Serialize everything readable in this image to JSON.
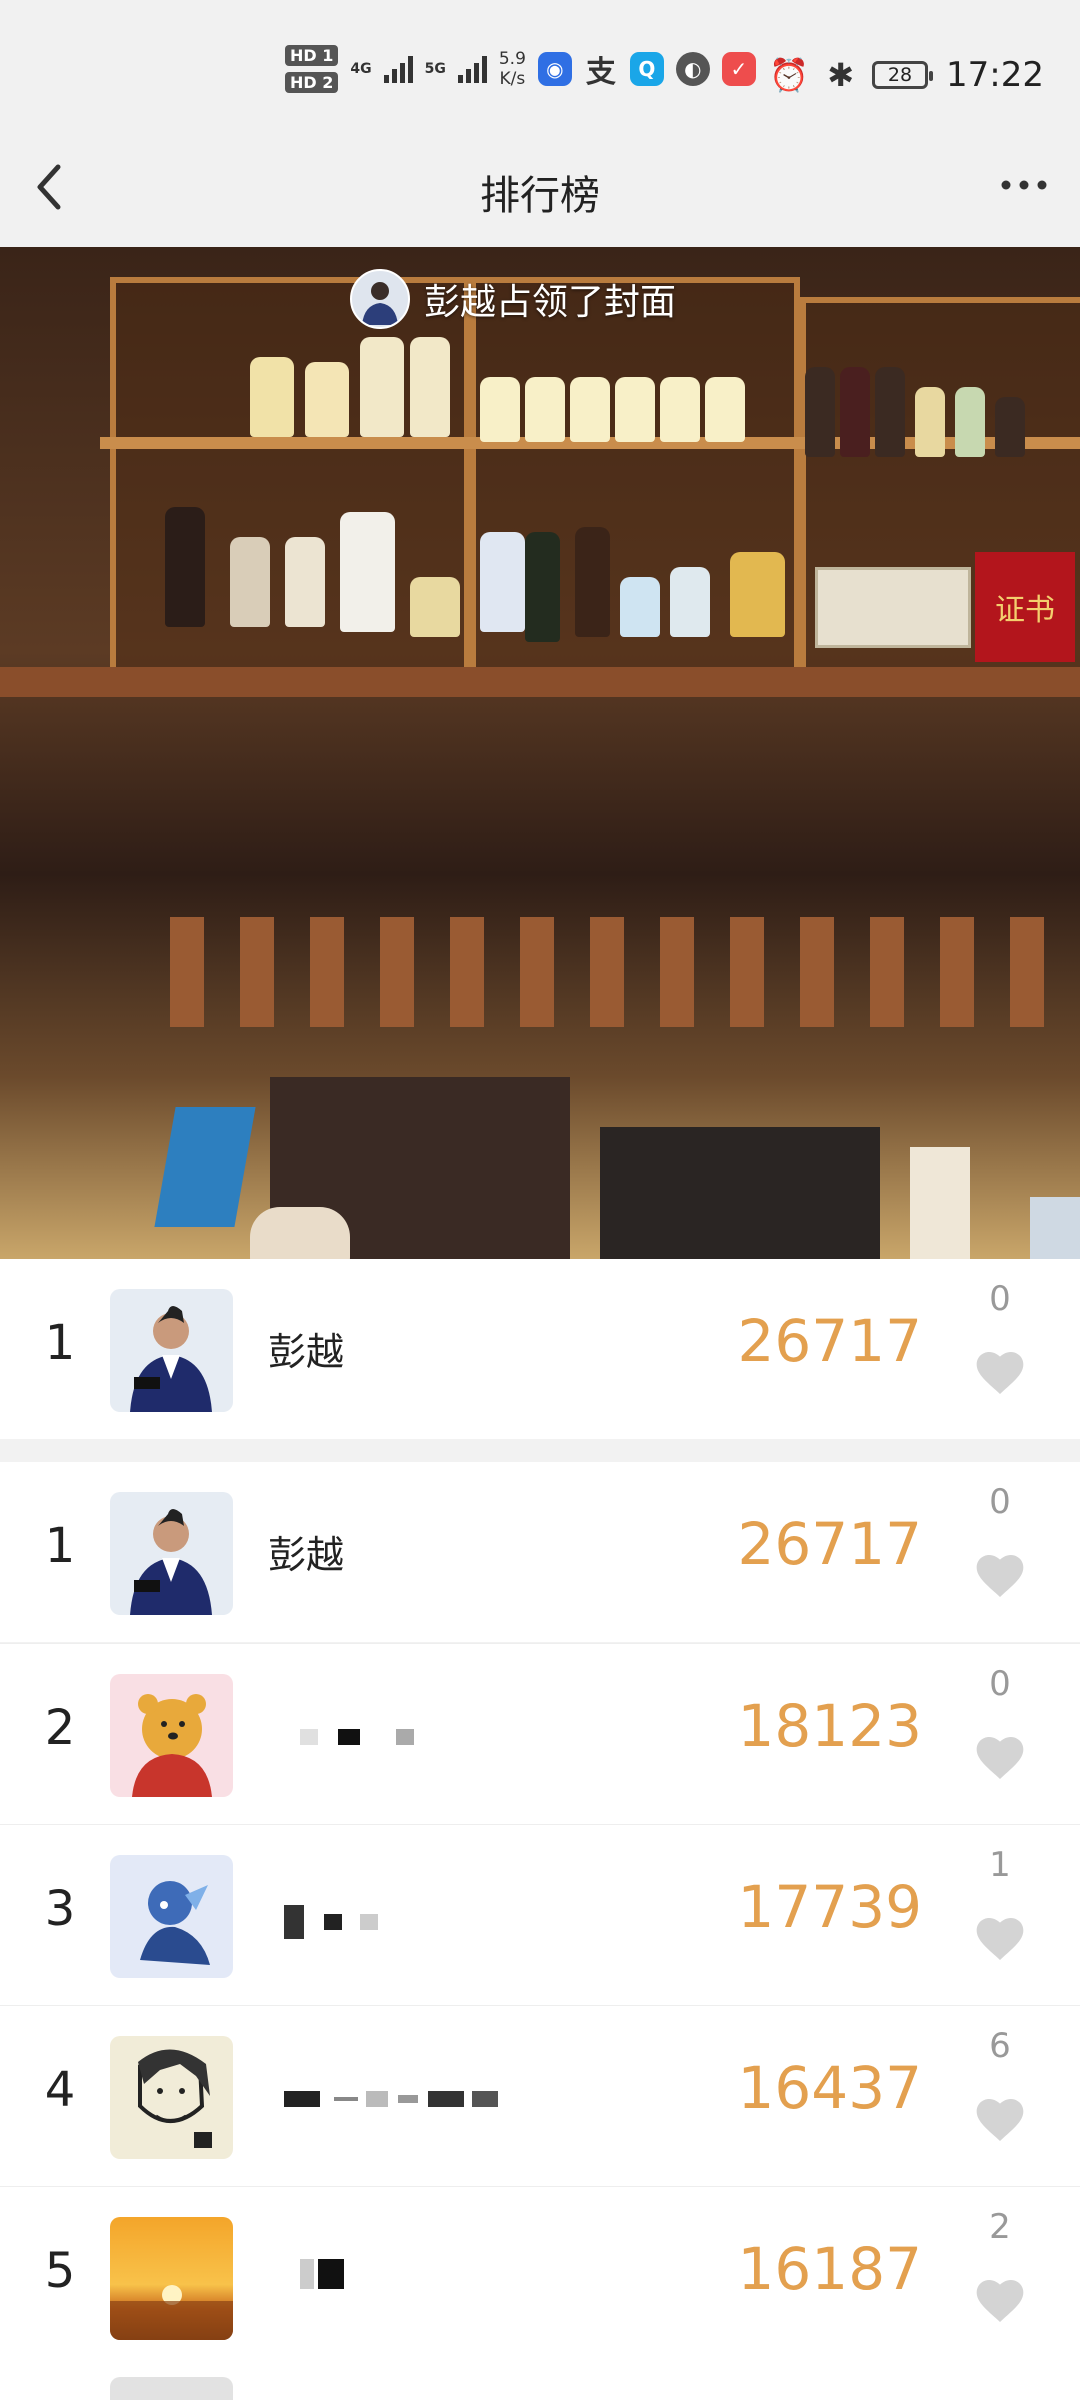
{
  "status_bar": {
    "sim_labels": [
      "HD 1",
      "HD 2"
    ],
    "network_1": "4G",
    "network_2": "5G",
    "speed_value": "5.9",
    "speed_unit": "K/s",
    "battery": "28",
    "time": "17:22",
    "app_icons": [
      "lightbulb-app-icon",
      "alipay-icon",
      "search-app-icon",
      "compass-app-icon",
      "heart-app-icon"
    ]
  },
  "nav": {
    "back_icon": "chevron-left-icon",
    "title": "排行榜",
    "more_icon": "more-dots-icon"
  },
  "cover": {
    "banner_text": "彭越占领了封面",
    "sign_text": "证书"
  },
  "my_rank": {
    "rank": "1",
    "name": "彭越",
    "score": "26717",
    "likes": "0"
  },
  "leaderboard": [
    {
      "rank": "1",
      "name": "彭越",
      "score": "26717",
      "likes": "0",
      "avatar": "graduate-photo"
    },
    {
      "rank": "2",
      "name": "",
      "score": "18123",
      "likes": "0",
      "avatar": "winnie-the-pooh"
    },
    {
      "rank": "3",
      "name": "",
      "score": "17739",
      "likes": "1",
      "avatar": "blue-anime-character"
    },
    {
      "rank": "4",
      "name": "",
      "score": "16437",
      "likes": "6",
      "avatar": "sketch-portrait"
    },
    {
      "rank": "5",
      "name": "",
      "score": "16187",
      "likes": "2",
      "avatar": "sunset"
    }
  ],
  "colors": {
    "score": "#e3a04f",
    "heart": "#d4d4d4",
    "background": "#f2f2f2"
  }
}
